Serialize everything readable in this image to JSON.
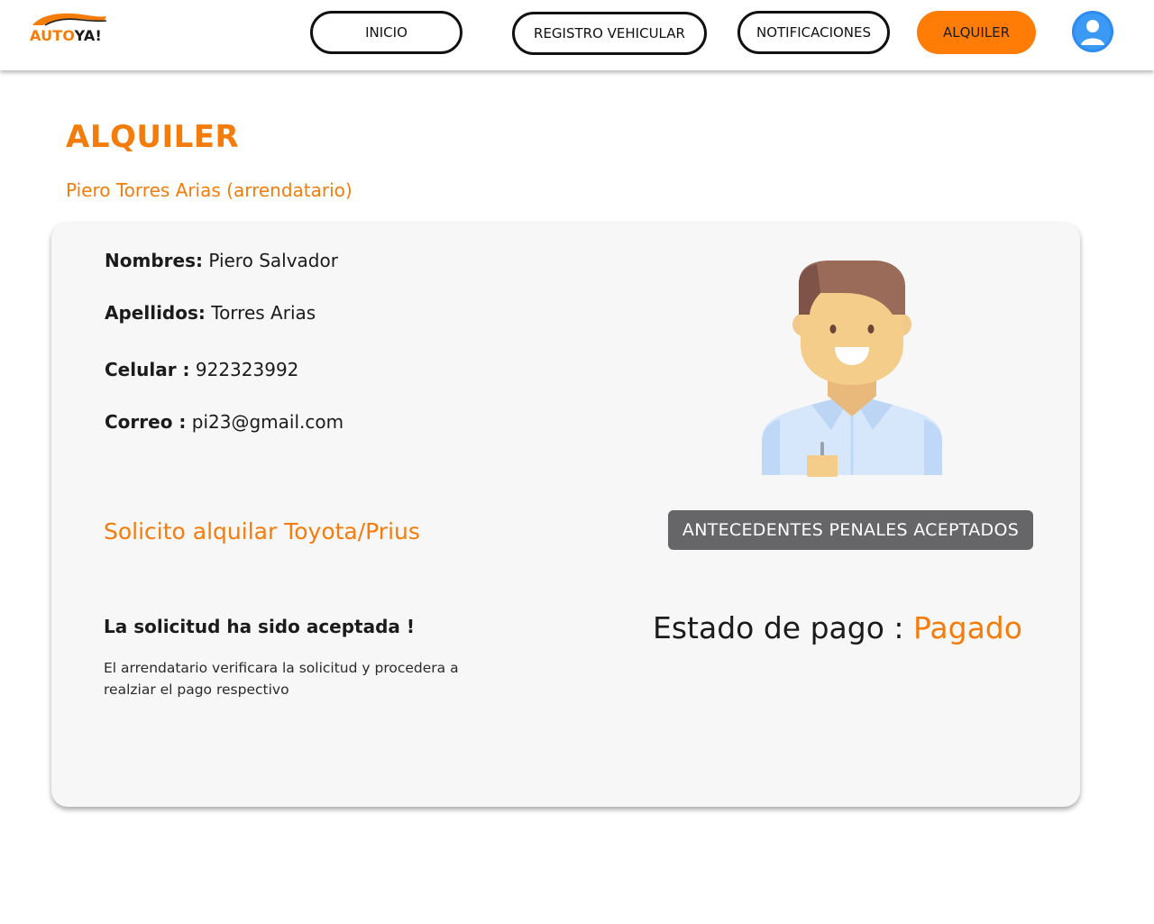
{
  "brand": {
    "logo_part1": "AUTO",
    "logo_part2": "YA!",
    "colors": {
      "accent": "#ff7d06",
      "text": "#1b1b1b",
      "card_bg": "#f7f7f7",
      "badge_bg": "#666568"
    }
  },
  "nav": {
    "inicio": "INICIO",
    "registro": "REGISTRO VEHICULAR",
    "notificaciones": "NOTIFICACIONES",
    "alquiler": "ALQUILER",
    "profile_icon": "user-avatar-icon"
  },
  "page": {
    "title": "ALQUILER",
    "subtitle": "Piero Torres Arias (arrendatario)"
  },
  "tenant": {
    "nombres_label": "Nombres:",
    "nombres_value": "Piero Salvador",
    "apellidos_label": "Apellidos:",
    "apellidos_value": "Torres Arias",
    "celular_label": "Celular :",
    "celular_value": "922323992",
    "correo_label": "Correo :",
    "correo_value": "pi23@gmail.com",
    "avatar_icon": "person-illustration-icon"
  },
  "request": {
    "solicito": "Solicito alquilar  Toyota/Prius",
    "antecedentes": "ANTECEDENTES PENALES  ACEPTADOS",
    "status_title": "La solicitud ha sido aceptada !",
    "status_desc": "El arrendatario verificara la solicitud y procedera a realziar el pago respectivo",
    "pago_label": "Estado de pago : ",
    "pago_value": "Pagado"
  }
}
